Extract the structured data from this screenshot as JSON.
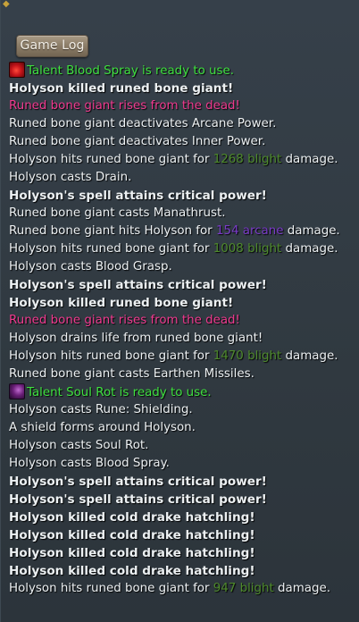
{
  "tab": {
    "label": "Game Log"
  },
  "log": [
    {
      "parts": [
        {
          "t": "Talent Blood Spray is ready to use."
        }
      ],
      "style": "green",
      "icon": "blood-spray-icon"
    },
    {
      "parts": [
        {
          "t": "Holyson killed runed bone giant!"
        }
      ],
      "style": "bold"
    },
    {
      "parts": [
        {
          "t": "Runed bone giant rises from the dead!"
        }
      ],
      "style": "pink"
    },
    {
      "parts": [
        {
          "t": "Runed bone giant deactivates Arcane Power."
        }
      ]
    },
    {
      "parts": [
        {
          "t": "Runed bone giant deactivates Inner Power."
        }
      ]
    },
    {
      "parts": [
        {
          "t": "Holyson hits runed bone giant for "
        },
        {
          "t": "1268 blight",
          "c": "blight"
        },
        {
          "t": " damage."
        }
      ]
    },
    {
      "parts": [
        {
          "t": "Holyson casts Drain."
        }
      ]
    },
    {
      "parts": [
        {
          "t": "Holyson's spell attains critical power!"
        }
      ],
      "style": "bold"
    },
    {
      "parts": [
        {
          "t": "Runed bone giant casts Manathrust."
        }
      ]
    },
    {
      "parts": [
        {
          "t": "Runed bone giant hits Holyson for "
        },
        {
          "t": "154 arcane",
          "c": "arcane"
        },
        {
          "t": " damage."
        }
      ]
    },
    {
      "parts": [
        {
          "t": "Holyson hits runed bone giant for "
        },
        {
          "t": "1008 blight",
          "c": "blight"
        },
        {
          "t": " damage."
        }
      ]
    },
    {
      "parts": [
        {
          "t": "Holyson casts Blood Grasp."
        }
      ]
    },
    {
      "parts": [
        {
          "t": "Holyson's spell attains critical power!"
        }
      ],
      "style": "bold"
    },
    {
      "parts": [
        {
          "t": "Holyson killed runed bone giant!"
        }
      ],
      "style": "bold"
    },
    {
      "parts": [
        {
          "t": "Runed bone giant rises from the dead!"
        }
      ],
      "style": "pink"
    },
    {
      "parts": [
        {
          "t": "Holyson drains life from runed bone giant!"
        }
      ]
    },
    {
      "parts": [
        {
          "t": "Holyson hits runed bone giant for "
        },
        {
          "t": "1470 blight",
          "c": "blight"
        },
        {
          "t": " damage."
        }
      ]
    },
    {
      "parts": [
        {
          "t": "Runed bone giant casts Earthen Missiles."
        }
      ]
    },
    {
      "parts": [
        {
          "t": "Talent Soul Rot is ready to use."
        }
      ],
      "style": "green",
      "icon": "soul-rot-icon"
    },
    {
      "parts": [
        {
          "t": "Holyson casts Rune: Shielding."
        }
      ]
    },
    {
      "parts": [
        {
          "t": "A shield forms around Holyson."
        }
      ]
    },
    {
      "parts": [
        {
          "t": "Holyson casts Soul Rot."
        }
      ]
    },
    {
      "parts": [
        {
          "t": "Holyson casts Blood Spray."
        }
      ]
    },
    {
      "parts": [
        {
          "t": "Holyson's spell attains critical power!"
        }
      ],
      "style": "bold"
    },
    {
      "parts": [
        {
          "t": "Holyson's spell attains critical power!"
        }
      ],
      "style": "bold"
    },
    {
      "parts": [
        {
          "t": "Holyson killed cold drake hatchling!"
        }
      ],
      "style": "bold"
    },
    {
      "parts": [
        {
          "t": "Holyson killed cold drake hatchling!"
        }
      ],
      "style": "bold"
    },
    {
      "parts": [
        {
          "t": "Holyson killed cold drake hatchling!"
        }
      ],
      "style": "bold"
    },
    {
      "parts": [
        {
          "t": "Holyson killed cold drake hatchling!"
        }
      ],
      "style": "bold"
    },
    {
      "parts": [
        {
          "t": "Holyson hits runed bone giant for "
        },
        {
          "t": "947 blight",
          "c": "blight"
        },
        {
          "t": " damage."
        }
      ]
    }
  ],
  "colors": {
    "background": "#323b42",
    "talent_ready": "#3fe03f",
    "rises": "#ef3a8f",
    "blight": "#4e8a2c",
    "arcane": "#7a3cc8",
    "text": "#ecf0f2"
  }
}
